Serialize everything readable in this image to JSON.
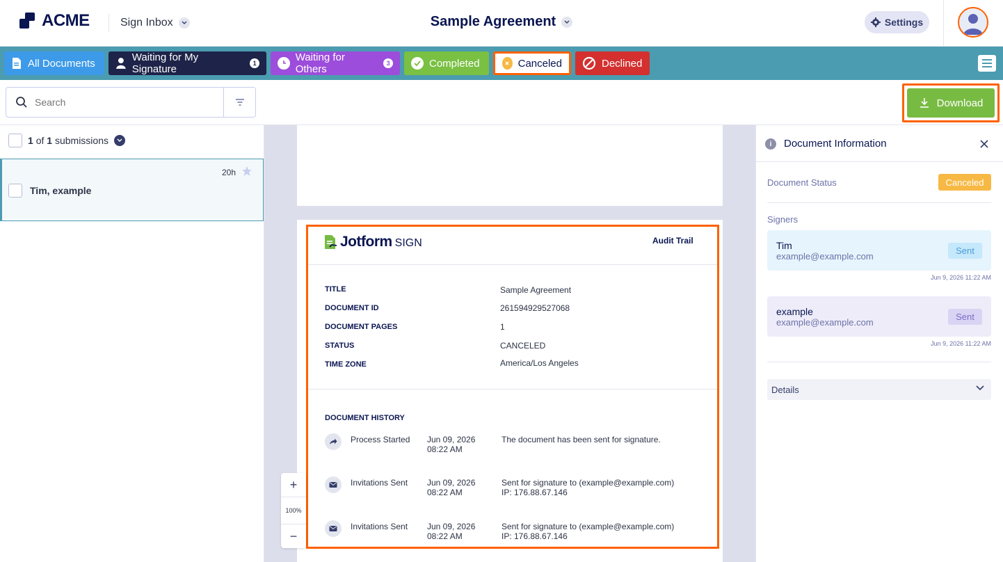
{
  "header": {
    "logo_text": "ACME",
    "inbox_label": "Sign Inbox",
    "document_title": "Sample Agreement",
    "settings_label": "Settings"
  },
  "tabs": [
    {
      "label": "All Documents",
      "badge": ""
    },
    {
      "label": "Waiting for My Signature",
      "badge": "1"
    },
    {
      "label": "Waiting for Others",
      "badge": "3"
    },
    {
      "label": "Completed",
      "badge": ""
    },
    {
      "label": "Canceled",
      "badge": ""
    },
    {
      "label": "Declined",
      "badge": ""
    }
  ],
  "active_tab": "Canceled",
  "toolbar": {
    "search_placeholder": "Search",
    "download_label": "Download"
  },
  "submissions": {
    "count_current": "1",
    "count_of": "of",
    "count_total": "1",
    "count_suffix": "submissions",
    "items": [
      {
        "name": "Tim, example",
        "time": "20h"
      }
    ]
  },
  "audit": {
    "brand_main": "Jotform",
    "brand_sub": "SIGN",
    "header_label": "Audit Trail",
    "fields": [
      {
        "label": "TITLE",
        "value": "Sample Agreement"
      },
      {
        "label": "DOCUMENT ID",
        "value": "261594929527068"
      },
      {
        "label": "DOCUMENT PAGES",
        "value": "1"
      },
      {
        "label": "STATUS",
        "value": "CANCELED"
      },
      {
        "label": "TIME ZONE",
        "value": "America/Los Angeles"
      }
    ],
    "history_title": "DOCUMENT HISTORY",
    "history": [
      {
        "icon": "share-arrow-icon",
        "event": "Process Started",
        "date": "Jun 09, 2026",
        "time": "08:22 AM",
        "desc": "The document has been sent for signature.",
        "ip": ""
      },
      {
        "icon": "envelope-icon",
        "event": "Invitations Sent",
        "date": "Jun 09, 2026",
        "time": "08:22 AM",
        "desc": "Sent for signature to (example@example.com)",
        "ip": "IP: 176.88.67.146"
      },
      {
        "icon": "envelope-icon",
        "event": "Invitations Sent",
        "date": "Jun 09, 2026",
        "time": "08:22 AM",
        "desc": "Sent for signature to (example@example.com)",
        "ip": "IP: 176.88.67.146"
      }
    ]
  },
  "zoom": {
    "plus": "+",
    "level": "100%",
    "minus": "−"
  },
  "info_panel": {
    "title": "Document Information",
    "status_label": "Document Status",
    "status_value": "Canceled",
    "signers_label": "Signers",
    "signers": [
      {
        "name": "Tim",
        "email": "example@example.com",
        "status": "Sent",
        "timestamp": "Jun 9, 2026 11:22 AM"
      },
      {
        "name": "example",
        "email": "example@example.com",
        "status": "Sent",
        "timestamp": "Jun 9, 2026 11:22 AM"
      }
    ],
    "details_label": "Details"
  },
  "colors": {
    "accent_orange": "#ff6100",
    "tabbar": "#4b9cb0",
    "status_canceled": "#f7b944",
    "download_green": "#78bb43"
  }
}
